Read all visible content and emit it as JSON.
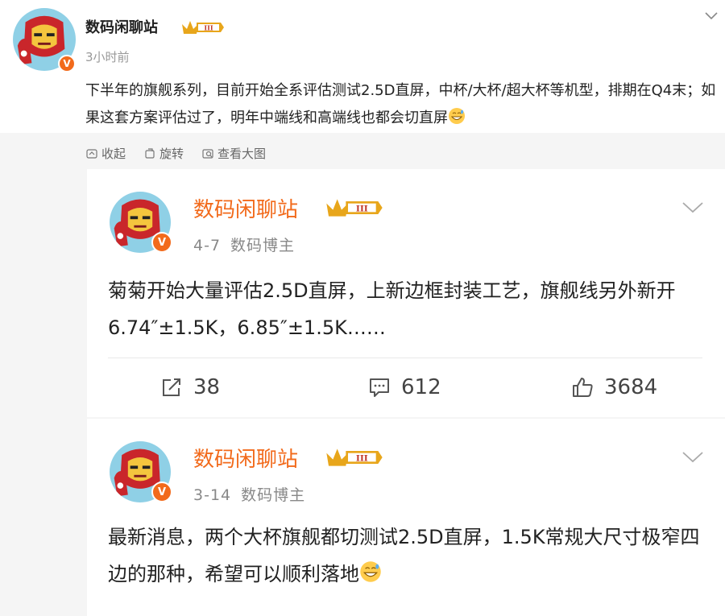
{
  "post": {
    "author": "数码闲聊站",
    "level_badge": "III",
    "verified_mark": "V",
    "time": "3小时前",
    "text": "下半年的旗舰系列，目前开始全系评估测试2.5D直屏，中杯/大杯/超大杯等机型，排期在Q4末；如果这套方案评估过了，明年中端线和高端线也都会切直屏",
    "emoji_icon": "grin-sweat-emoji",
    "actions": {
      "collect": "收起",
      "repost": "旋转",
      "view_large": "查看大图"
    }
  },
  "cards": [
    {
      "author": "数码闲聊站",
      "level_badge": "III",
      "verified_mark": "V",
      "date": "4-7",
      "role": "数码博主",
      "text": "菊菊开始大量评估2.5D直屏，上新边框封装工艺，旗舰线另外新开6.74″±1.5K，6.85″±1.5K……",
      "stats": {
        "reposts": "38",
        "comments": "612",
        "likes": "3684"
      }
    },
    {
      "author": "数码闲聊站",
      "level_badge": "III",
      "verified_mark": "V",
      "date": "3-14",
      "role": "数码博主",
      "text": "最新消息，两个大杯旗舰都切测试2.5D直屏，1.5K常规大尺寸极窄四边的那种，希望可以顺利落地"
    }
  ],
  "colors": {
    "accent": "#f26a1b",
    "gold": "#e8a61b",
    "page_bg": "#ffffff",
    "retweet_bg": "#f5f5f5"
  }
}
